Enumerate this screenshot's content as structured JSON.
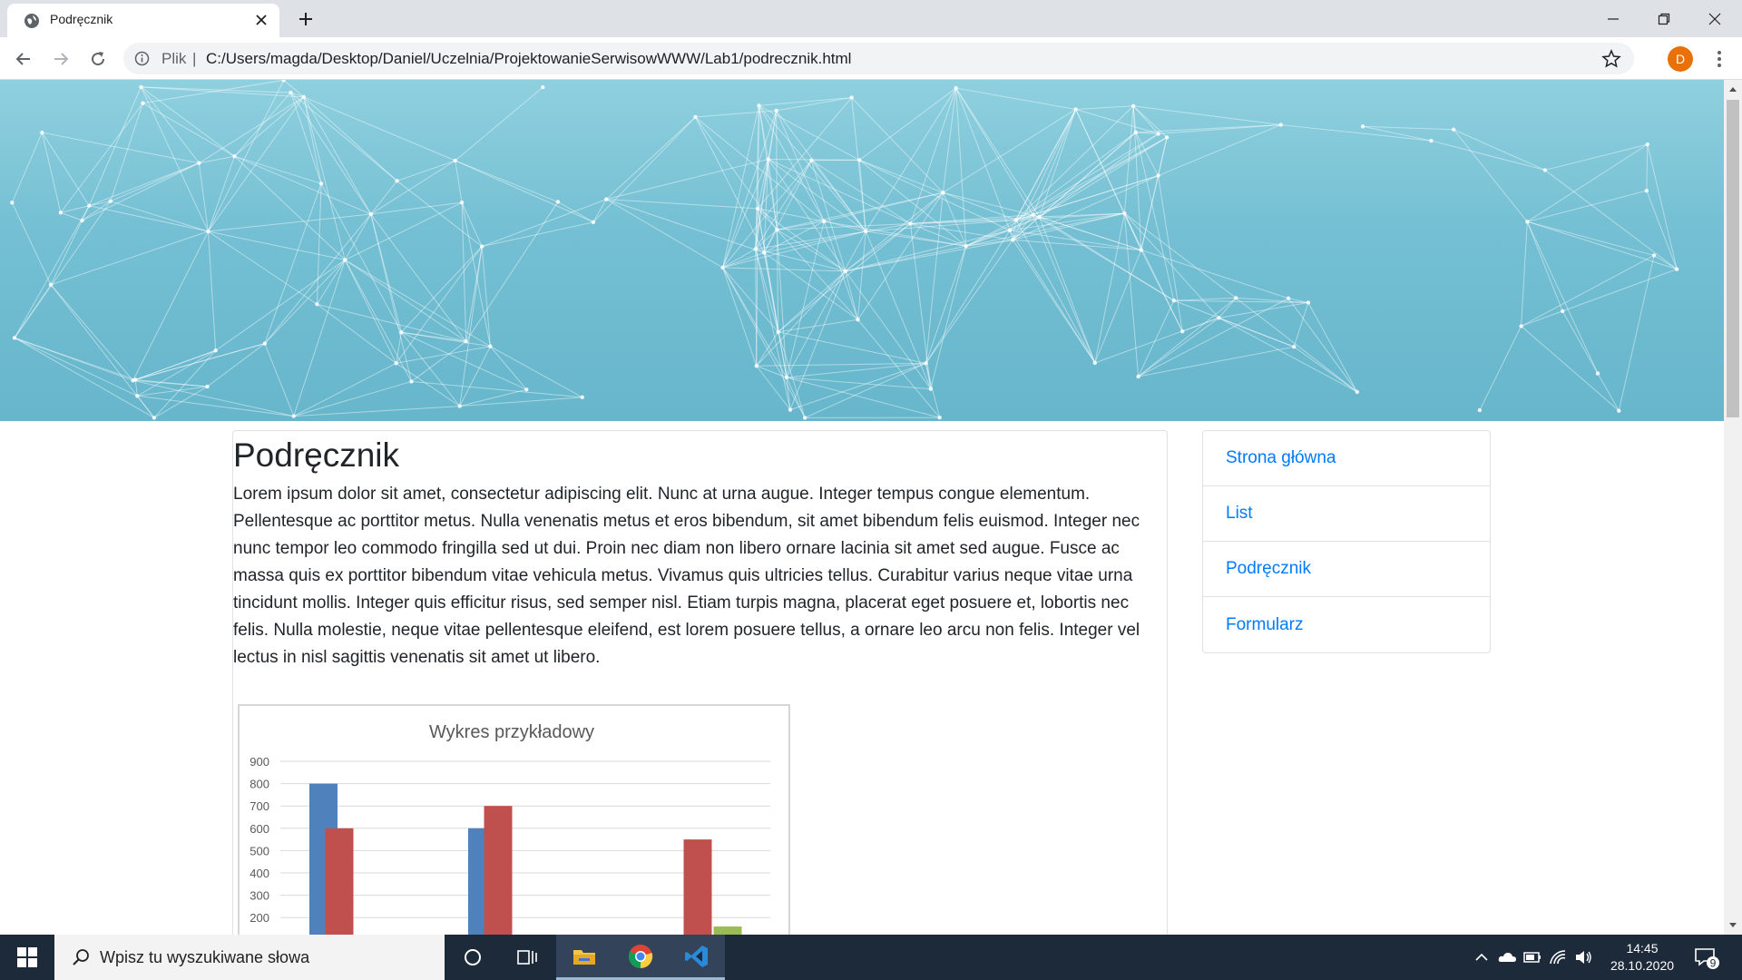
{
  "browser": {
    "tab_title": "Podręcznik",
    "address_label": "Plik",
    "address_separator": "|",
    "url": "C:/Users/magda/Desktop/Daniel/Uczelnia/ProjektowanieSerwisowWWW/Lab1/podrecznik.html",
    "profile_initial": "D",
    "accent_color": "#e8710a"
  },
  "page": {
    "title": "Podręcznik",
    "paragraph": "Lorem ipsum dolor sit amet, consectetur adipiscing elit. Nunc at urna augue. Integer tempus congue elementum. Pellentesque ac porttitor metus. Nulla venenatis metus et eros bibendum, sit amet bibendum felis euismod. Integer nec nunc tempor leo commodo fringilla sed ut dui. Proin nec diam non libero ornare lacinia sit amet sed augue. Fusce ac massa quis ex porttitor bibendum vitae vehicula metus. Vivamus quis ultricies tellus. Curabitur varius neque vitae urna tincidunt mollis. Integer quis efficitur risus, sed semper nisl. Etiam turpis magna, placerat eget posuere et, lobortis nec felis. Nulla molestie, neque vitae pellentesque eleifend, est lorem posuere tellus, a ornare leo arcu non felis. Integer vel lectus in nisl sagittis venenatis sit amet ut libero.",
    "link_color": "#007bff"
  },
  "sidebar": {
    "items": [
      {
        "label": "Strona główna"
      },
      {
        "label": "List"
      },
      {
        "label": "Podręcznik"
      },
      {
        "label": "Formularz"
      }
    ]
  },
  "chart_data": {
    "type": "bar",
    "title": "Wykres przykładowy",
    "xlabel": "",
    "ylabel": "",
    "ylim": [
      100,
      900
    ],
    "y_ticks": [
      "900",
      "800",
      "700",
      "600",
      "500",
      "400",
      "300",
      "200"
    ],
    "grid": true,
    "series": [
      {
        "color": "#4f81bd",
        "values": [
          800,
          600,
          0
        ]
      },
      {
        "color": "#c0504d",
        "values": [
          600,
          700,
          550
        ]
      },
      {
        "color": "#9bbb59",
        "values": [
          0,
          0,
          160
        ]
      }
    ]
  },
  "taskbar": {
    "search_placeholder": "Wpisz tu wyszukiwane słowa",
    "time": "14:45",
    "date": "28.10.2020",
    "notification_count": "9"
  }
}
